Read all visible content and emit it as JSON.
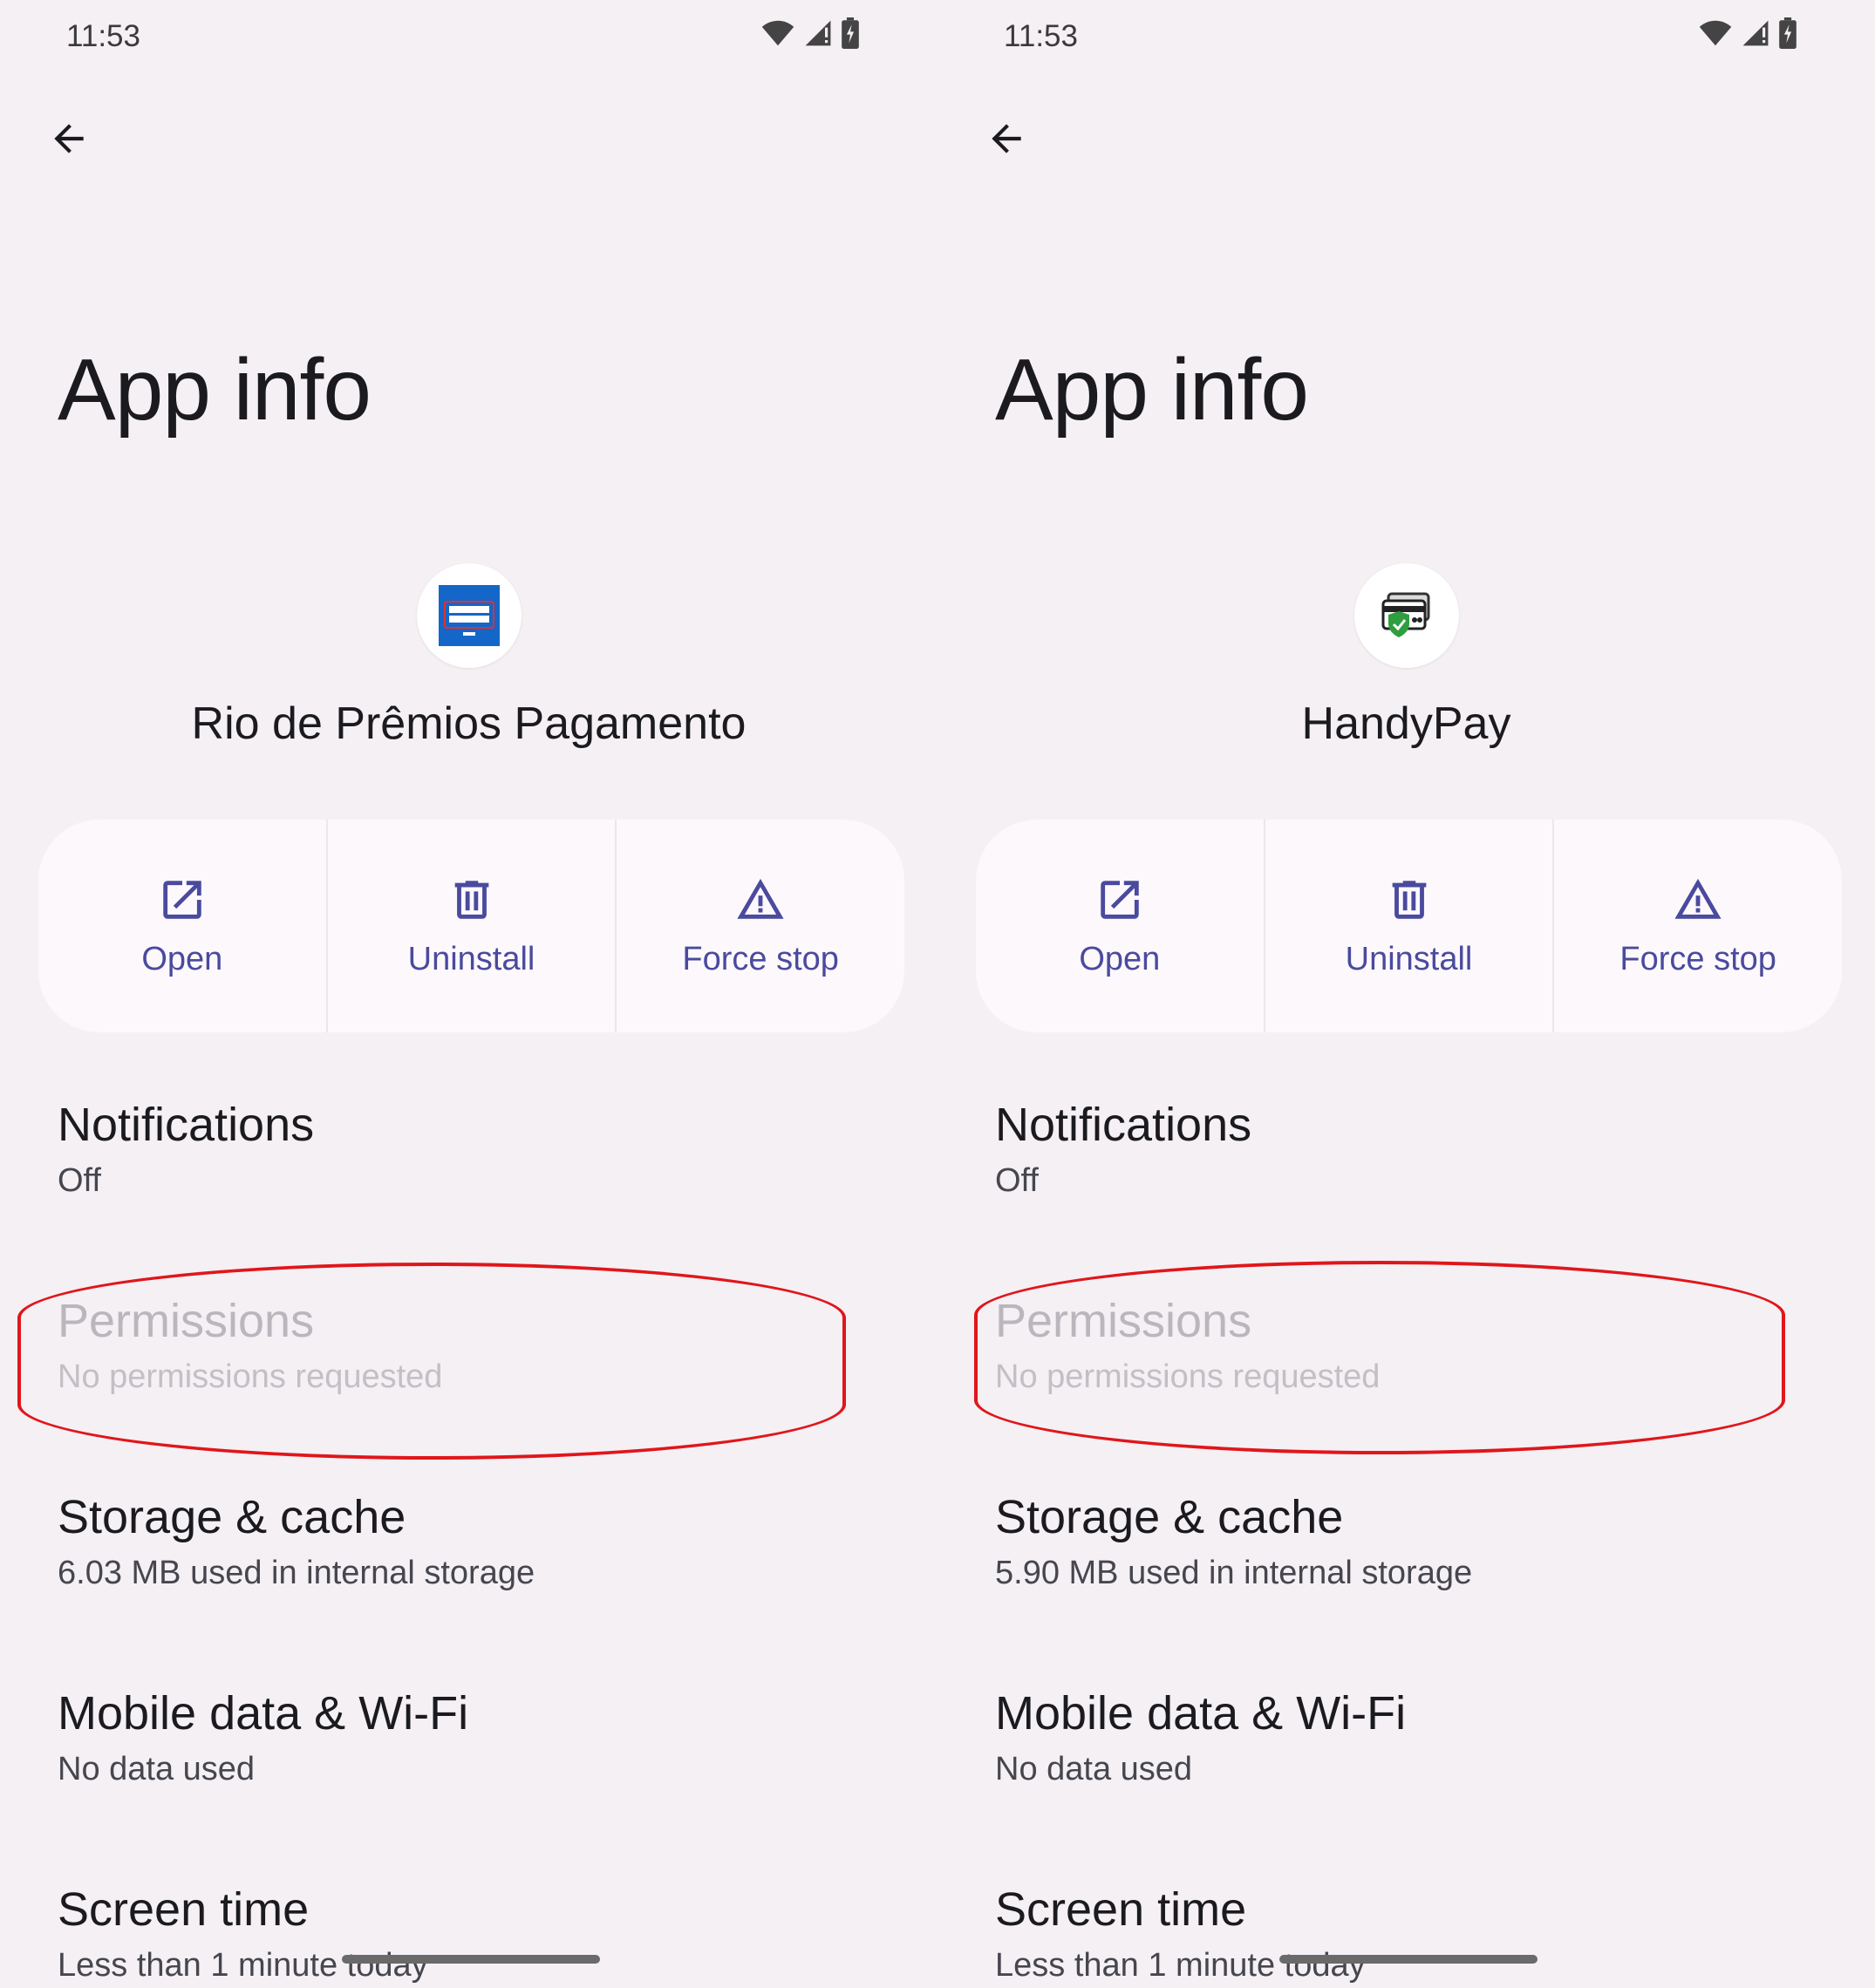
{
  "screens": [
    {
      "status": {
        "time": "11:53"
      },
      "title": "App info",
      "app": {
        "name": "Rio de Prêmios Pagamento",
        "icon": "rio-de-premios-app-icon"
      },
      "actions": {
        "open": "Open",
        "uninstall": "Uninstall",
        "force_stop": "Force stop"
      },
      "items": {
        "notifications": {
          "title": "Notifications",
          "subtitle": "Off"
        },
        "permissions": {
          "title": "Permissions",
          "subtitle": "No permissions requested"
        },
        "storage": {
          "title": "Storage & cache",
          "subtitle": "6.03 MB used in internal storage"
        },
        "mobile_data": {
          "title": "Mobile data & Wi-Fi",
          "subtitle": "No data used"
        },
        "screen_time": {
          "title": "Screen time",
          "subtitle": "Less than 1 minute today"
        }
      }
    },
    {
      "status": {
        "time": "11:53"
      },
      "title": "App info",
      "app": {
        "name": "HandyPay",
        "icon": "handypay-app-icon"
      },
      "actions": {
        "open": "Open",
        "uninstall": "Uninstall",
        "force_stop": "Force stop"
      },
      "items": {
        "notifications": {
          "title": "Notifications",
          "subtitle": "Off"
        },
        "permissions": {
          "title": "Permissions",
          "subtitle": "No permissions requested"
        },
        "storage": {
          "title": "Storage & cache",
          "subtitle": "5.90 MB used in internal storage"
        },
        "mobile_data": {
          "title": "Mobile data & Wi-Fi",
          "subtitle": "No data used"
        },
        "screen_time": {
          "title": "Screen time",
          "subtitle": "Less than 1 minute today"
        }
      }
    }
  ],
  "colors": {
    "background": "#f4f0f4",
    "accent": "#4a4a9e",
    "highlight": "#e0161b"
  },
  "icons": [
    "wifi-icon",
    "signal-icon",
    "battery-icon",
    "back-arrow-icon",
    "open-icon",
    "trash-icon",
    "warning-icon"
  ]
}
